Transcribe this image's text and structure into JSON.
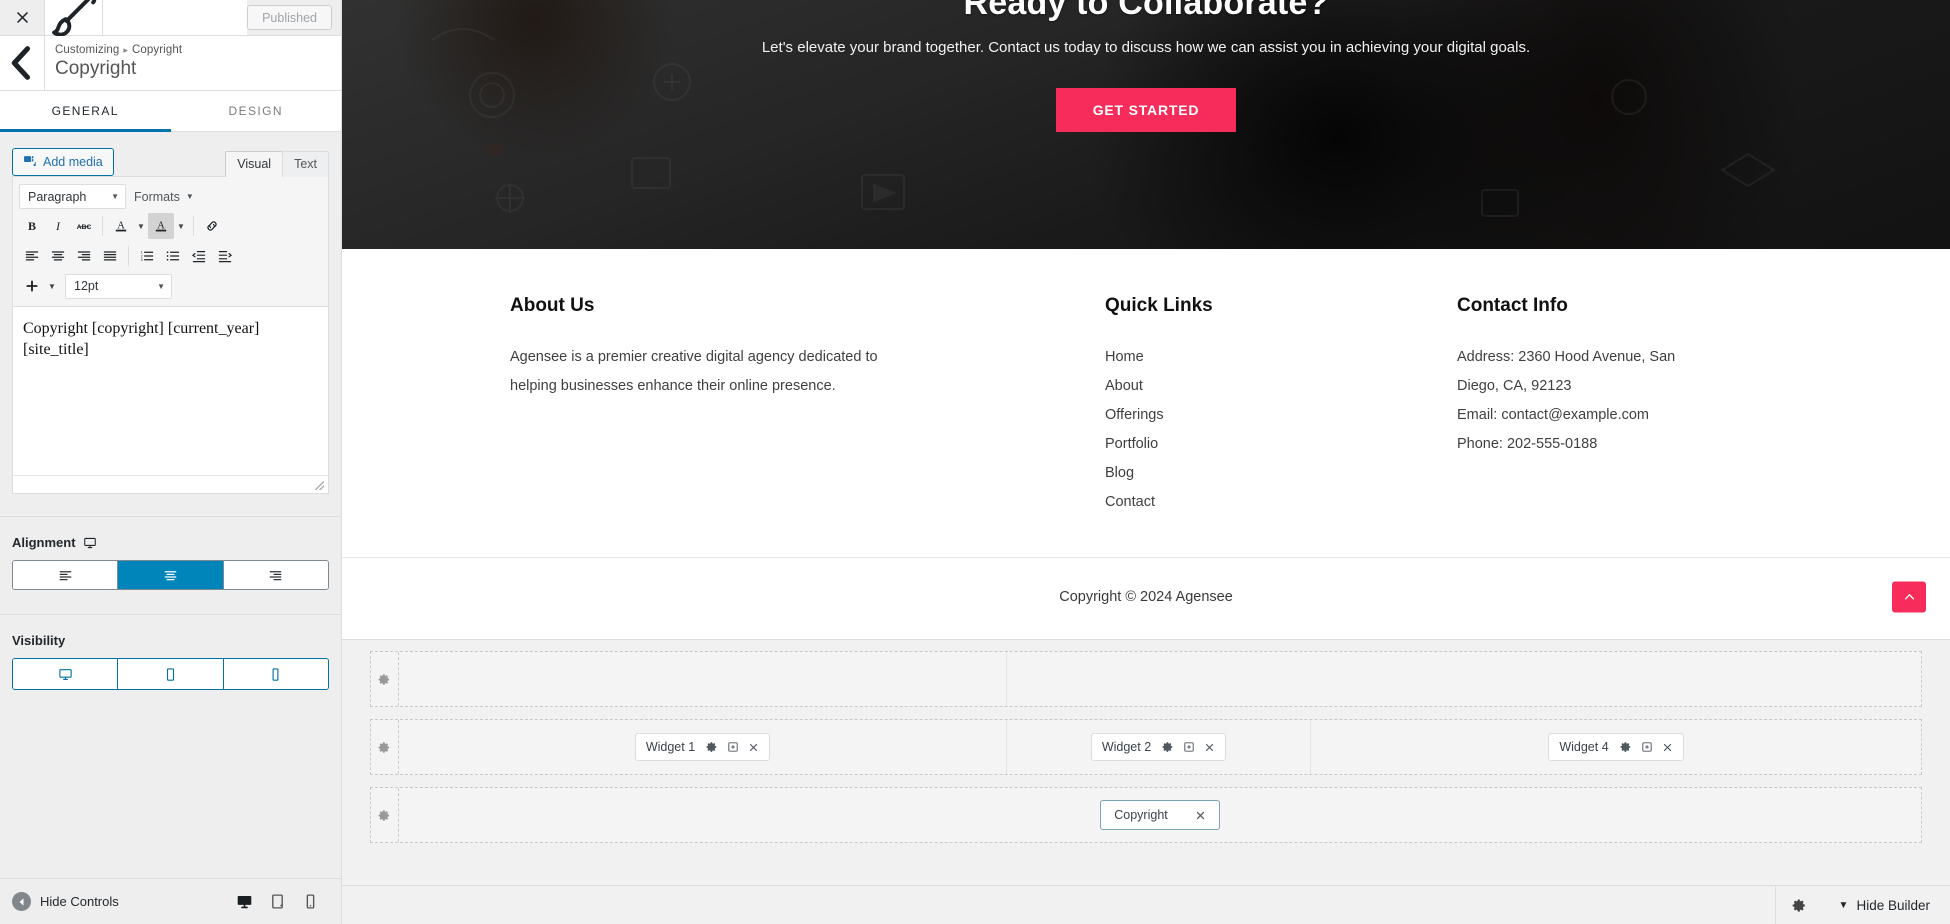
{
  "customizer": {
    "close_icon": "close-icon",
    "brush_icon": "paintbrush-icon",
    "published_label": "Published",
    "back_icon": "chevron-left-icon",
    "breadcrumb_root": "Customizing",
    "breadcrumb_sep": "▸",
    "breadcrumb_current": "Copyright",
    "panel_title": "Copyright",
    "tabs": [
      {
        "label": "GENERAL",
        "active": true
      },
      {
        "label": "DESIGN",
        "active": false
      }
    ]
  },
  "editor": {
    "add_media_label": "Add media",
    "add_media_icon": "media-icon",
    "mode_tabs": [
      {
        "label": "Visual",
        "active": true
      },
      {
        "label": "Text",
        "active": false
      }
    ],
    "paragraph_select": "Paragraph",
    "formats_label": "Formats",
    "fontsize_select": "12pt",
    "buttons": [
      "bold-icon",
      "italic-icon",
      "strikethrough-icon",
      "text-color-icon",
      "background-color-icon",
      "link-icon",
      "align-left-icon",
      "align-center-icon",
      "align-right-icon",
      "align-justify-icon",
      "ordered-list-icon",
      "unordered-list-icon",
      "outdent-icon",
      "indent-icon",
      "insert-more-icon"
    ],
    "content_line_1": "Copyright [copyright] [current_year]",
    "content_line_2": "[site_title]"
  },
  "alignment": {
    "label": "Alignment",
    "device_icon": "desktop-icon",
    "options": [
      {
        "icon": "align-left-icon",
        "active": false
      },
      {
        "icon": "align-center-icon",
        "active": true
      },
      {
        "icon": "align-right-icon",
        "active": false
      }
    ]
  },
  "visibility": {
    "label": "Visibility",
    "options": [
      {
        "icon": "desktop-icon",
        "active": true
      },
      {
        "icon": "tablet-icon",
        "active": true
      },
      {
        "icon": "mobile-icon",
        "active": true
      }
    ]
  },
  "sidebar_footer": {
    "hide_controls_label": "Hide Controls",
    "hide_controls_icon": "collapse-circle-icon",
    "devices": [
      {
        "icon": "desktop-icon",
        "active": true
      },
      {
        "icon": "tablet-icon",
        "active": false
      },
      {
        "icon": "mobile-icon",
        "active": false
      }
    ]
  },
  "preview": {
    "hero": {
      "title": "Ready to Collaborate?",
      "subtitle": "Let's elevate your brand together. Contact us today to discuss how we can assist you in achieving your digital goals.",
      "button_label": "GET STARTED",
      "button_color": "#f72c5b"
    },
    "footer_columns": [
      {
        "heading": "About Us",
        "type": "text",
        "text": "Agensee is a premier creative digital agency dedicated to helping businesses enhance their online presence."
      },
      {
        "heading": "Quick Links",
        "type": "links",
        "links": [
          "Home",
          "About",
          "Offerings",
          "Portfolio",
          "Blog",
          "Contact"
        ]
      },
      {
        "heading": "Contact Info",
        "type": "lines",
        "lines": [
          "Address: 2360 Hood Avenue, San",
          "Diego, CA, 92123",
          "Email: contact@example.com",
          "Phone: 202-555-0188"
        ]
      }
    ],
    "copyright_bar": {
      "text": "Copyright © 2024 Agensee",
      "to_top_icon": "chevron-up-icon",
      "to_top_color": "#f72c5b"
    }
  },
  "builder": {
    "rows": [
      {
        "gear_icon": "gear-icon",
        "columns": [
          {
            "chips": []
          },
          {
            "chips": []
          }
        ]
      },
      {
        "gear_icon": "gear-icon",
        "columns": [
          {
            "chips": [
              {
                "label": "Widget 1",
                "selected": false,
                "icons": [
                  "gear-icon",
                  "duplicate-icon",
                  "close-icon"
                ]
              }
            ]
          },
          {
            "chips": [
              {
                "label": "Widget 2",
                "selected": false,
                "icons": [
                  "gear-icon",
                  "duplicate-icon",
                  "close-icon"
                ]
              }
            ]
          },
          {
            "chips": [
              {
                "label": "Widget 4",
                "selected": false,
                "icons": [
                  "gear-icon",
                  "duplicate-icon",
                  "close-icon"
                ]
              }
            ]
          }
        ]
      },
      {
        "gear_icon": "gear-icon",
        "columns": [
          {
            "chips": [
              {
                "label": "Copyright",
                "selected": true,
                "icons": [
                  "close-icon"
                ]
              }
            ]
          }
        ]
      }
    ],
    "bottom_bar": {
      "gear_icon": "gear-icon",
      "hide_builder_label": "Hide Builder",
      "chevron_icon": "chevron-down-icon"
    }
  }
}
